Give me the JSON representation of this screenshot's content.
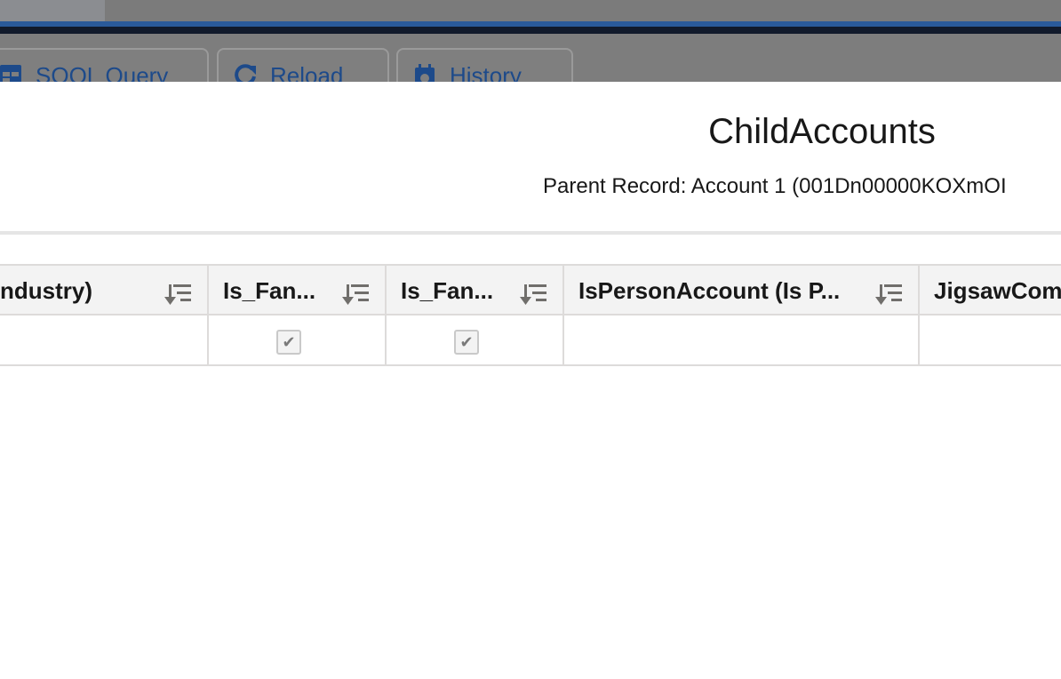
{
  "background": {
    "toolbar": {
      "soql_label": "SOQL Query",
      "reload_label": "Reload",
      "history_label": "History"
    }
  },
  "modal": {
    "title": "ChildAccounts",
    "subtitle": "Parent Record: Account 1 (001Dn00000KOXmOI"
  },
  "table": {
    "columns": [
      {
        "label": "ndustry)"
      },
      {
        "label": "Is_Fan..."
      },
      {
        "label": "Is_Fan..."
      },
      {
        "label": "IsPersonAccount (Is P..."
      },
      {
        "label": "JigsawCom"
      }
    ],
    "rows": [
      {
        "cells": [
          "",
          true,
          true,
          "",
          ""
        ]
      }
    ]
  },
  "icons": {
    "sort": "sort-descending-icon",
    "checkbox_checked": "checkbox-checked-icon",
    "soql": "table-icon",
    "reload": "refresh-icon",
    "history": "calendar-icon"
  },
  "colors": {
    "brand_blue": "#1d4a8a",
    "header_bg": "#f3f3f3",
    "border": "#dddbda",
    "text": "#181818"
  }
}
